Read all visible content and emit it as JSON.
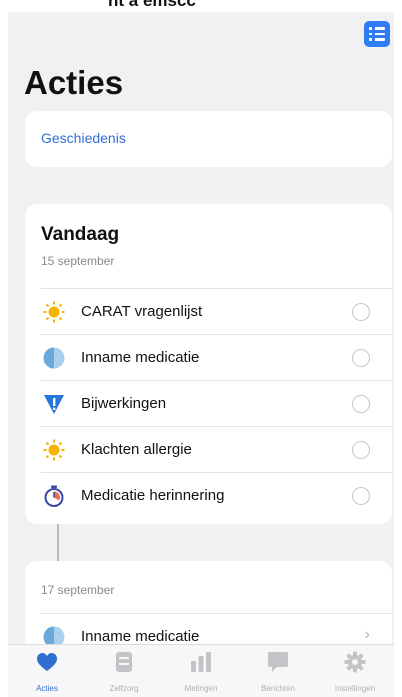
{
  "screen": {
    "title": "Acties",
    "history_link": "Geschiedenis"
  },
  "today": {
    "heading": "Vandaag",
    "date": "15 september",
    "tasks": [
      {
        "label": "CARAT vragenlijst",
        "icon": "sun-icon"
      },
      {
        "label": "Inname medicatie",
        "icon": "half-circle-icon"
      },
      {
        "label": "Bijwerkingen",
        "icon": "warning-triangle-icon"
      },
      {
        "label": "Klachten allergie",
        "icon": "sun-icon"
      },
      {
        "label": "Medicatie herinnering",
        "icon": "stopwatch-icon"
      }
    ]
  },
  "upcoming": {
    "date": "17 september",
    "tasks": [
      {
        "label": "Inname medicatie",
        "icon": "half-circle-icon"
      }
    ]
  },
  "tabbar": {
    "tabs": [
      {
        "label": "Acties",
        "icon": "heart-icon",
        "active": true
      },
      {
        "label": "Zelfzorg",
        "icon": "book-icon",
        "active": false
      },
      {
        "label": "Metingen",
        "icon": "bar-chart-icon",
        "active": false
      },
      {
        "label": "Berichten",
        "icon": "speech-bubble-icon",
        "active": false
      },
      {
        "label": "Instellingen",
        "icon": "gear-icon",
        "active": false
      }
    ]
  },
  "colors": {
    "accent": "#2f7cf6",
    "link": "#2f6fd1",
    "background": "#f1f1f4",
    "sun": "#f6b400",
    "medication": "#7fb8e3",
    "warning": "#2a74d8"
  }
}
